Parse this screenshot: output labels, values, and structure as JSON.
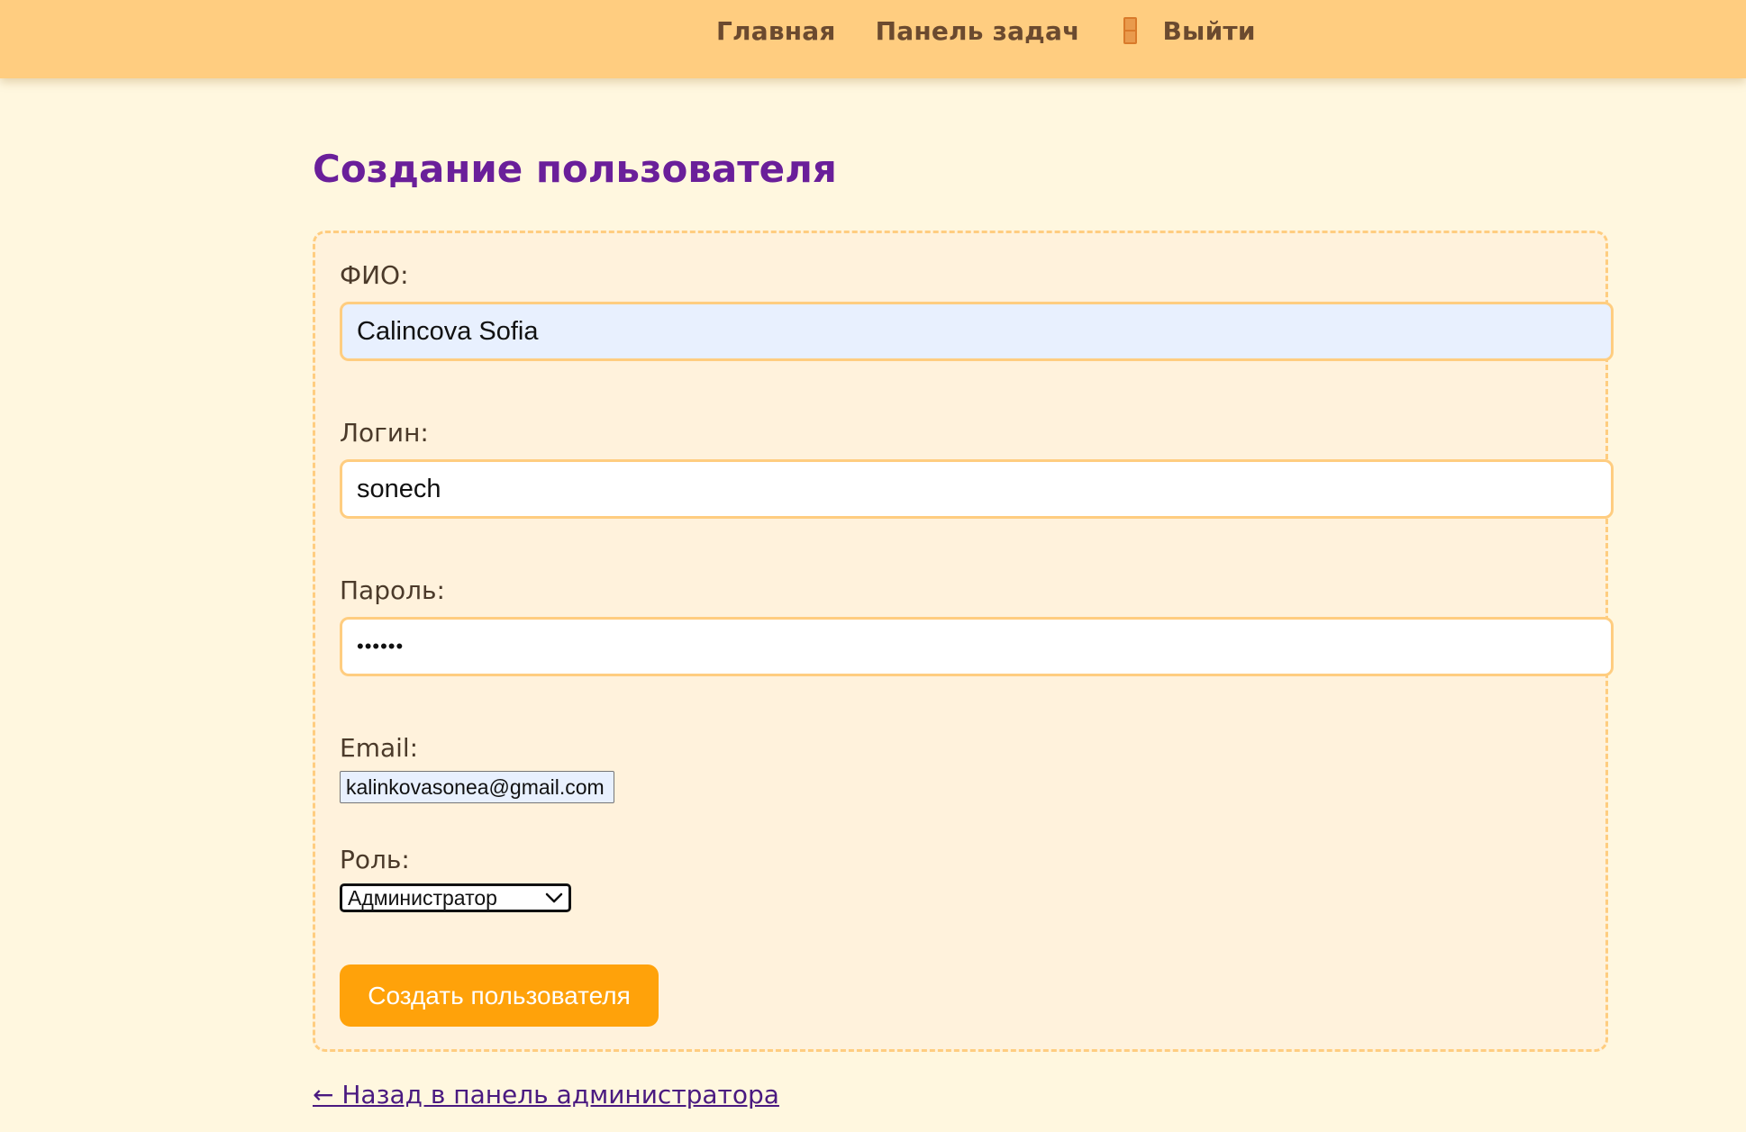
{
  "nav": {
    "home_label": "Главная",
    "tasks_label": "Панель задач",
    "logout_icon": "door-icon",
    "logout_label": "Выйти"
  },
  "page_title": "Создание пользователя",
  "form": {
    "fullname": {
      "label": "ФИО:",
      "value": "Calincova Sofia"
    },
    "login": {
      "label": "Логин:",
      "value": "sonech"
    },
    "password": {
      "label": "Пароль:",
      "value": "••••••"
    },
    "email": {
      "label": "Email:",
      "value": "kalinkovasonea@gmail.com"
    },
    "role": {
      "label": "Роль:",
      "selected": "Администратор"
    },
    "submit_label": "Создать пользователя"
  },
  "back_link": "← Назад в панель администратора",
  "colors": {
    "topbar": "#ffcd80",
    "page_background": "#fff7df",
    "title": "#6a1f9a",
    "button": "#ffa20a",
    "input_border": "#ffcd80",
    "autofill": "#e8f0fe"
  }
}
